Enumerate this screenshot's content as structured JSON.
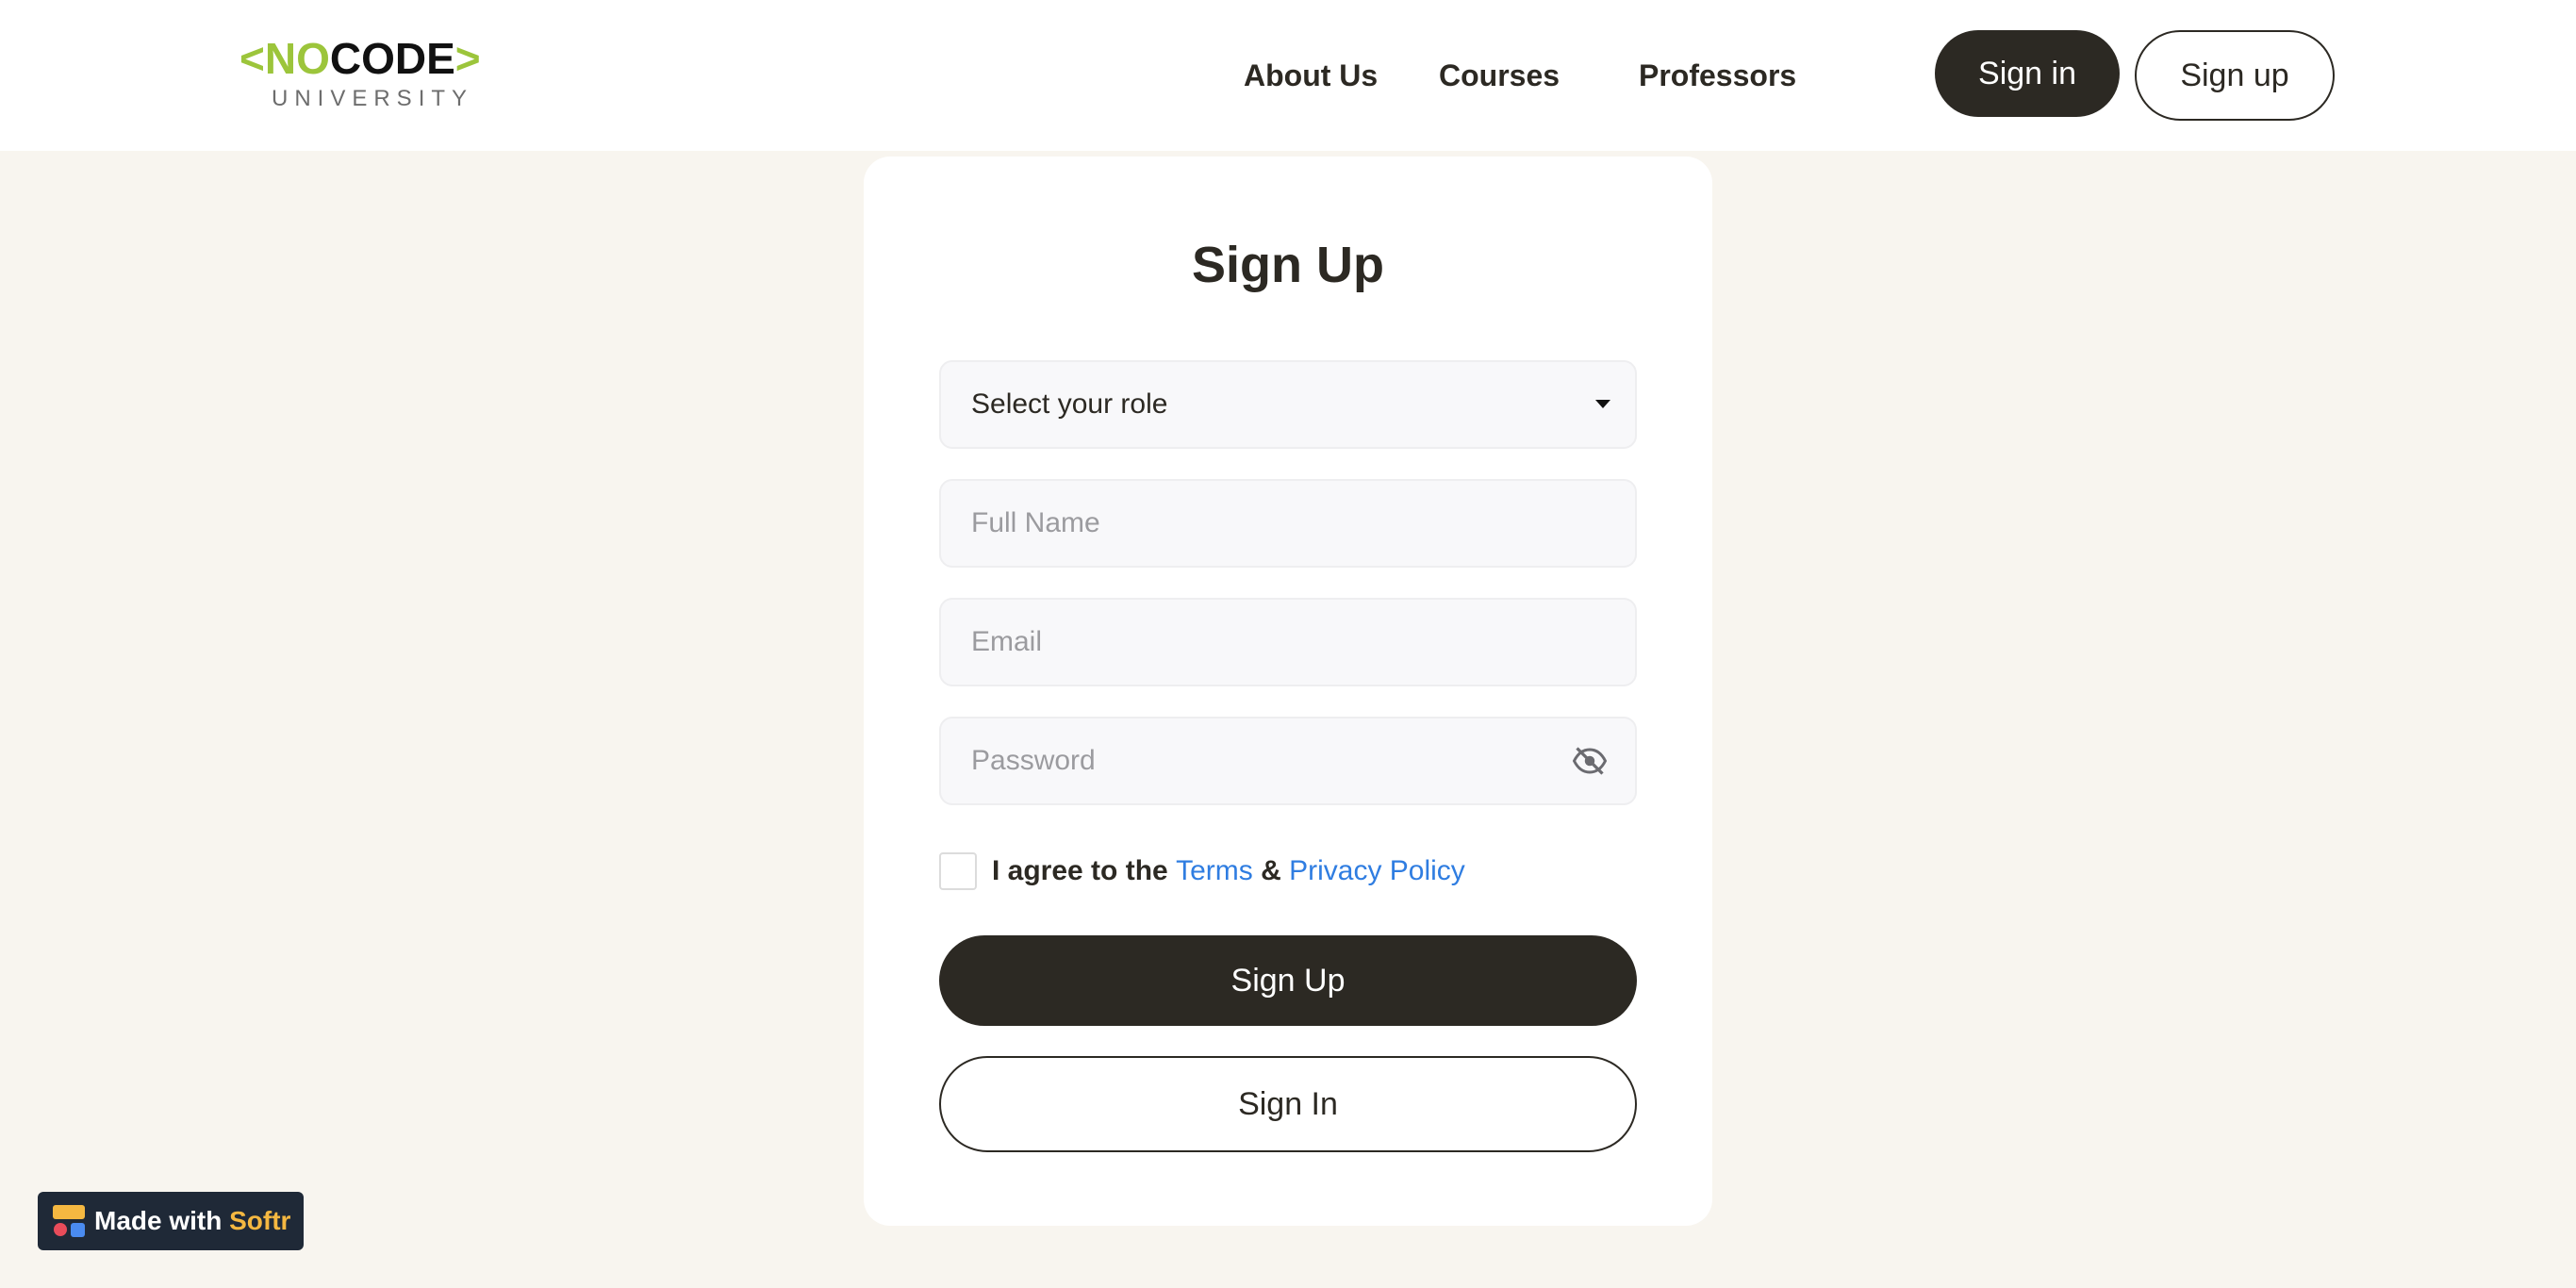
{
  "colors": {
    "accent_green": "#9cc53b",
    "dark": "#2c2923",
    "link_blue": "#2f7de1",
    "page_bg": "#f8f5ef"
  },
  "header": {
    "logo": {
      "left_chevron": "<",
      "no": "NO",
      "code": "CODE",
      "right_chevron": ">",
      "subtitle": "UNIVERSITY"
    },
    "nav": [
      {
        "label": "About Us"
      },
      {
        "label": "Courses"
      },
      {
        "label": "Professors"
      }
    ],
    "sign_in_label": "Sign in",
    "sign_up_label": "Sign up"
  },
  "form": {
    "title": "Sign Up",
    "role_select": {
      "selected": "Select your role",
      "icon": "chevron-down-icon"
    },
    "full_name": {
      "placeholder": "Full Name",
      "value": ""
    },
    "email": {
      "placeholder": "Email",
      "value": ""
    },
    "password": {
      "placeholder": "Password",
      "value": "",
      "icon": "eye-off-icon"
    },
    "agree": {
      "checked": false,
      "prefix": "I agree to the",
      "terms_label": "Terms",
      "ampersand": "&",
      "privacy_label": "Privacy Policy"
    },
    "submit_label": "Sign Up",
    "alt_label": "Sign In"
  },
  "badge": {
    "made_with": "Made with",
    "brand": "Softr"
  }
}
